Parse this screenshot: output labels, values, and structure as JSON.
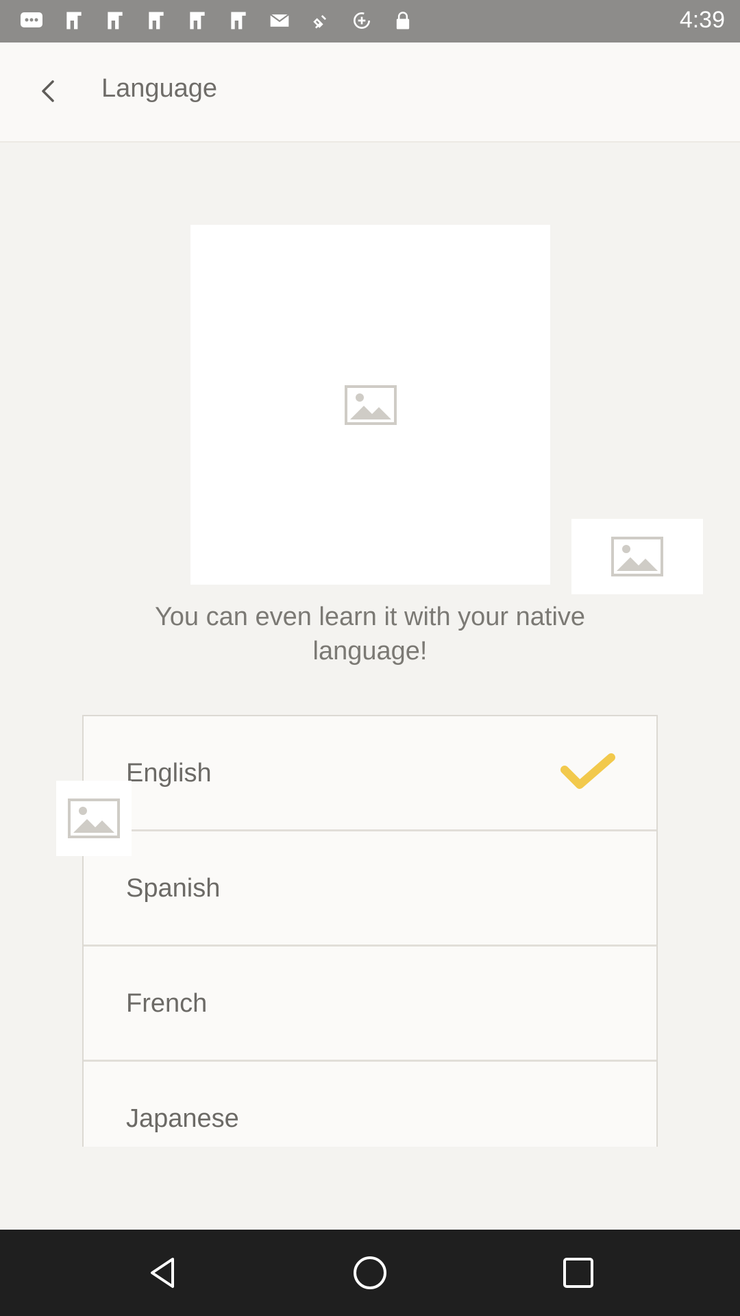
{
  "status_bar": {
    "time": "4:39",
    "icons": [
      "chat-bubble-icon",
      "game-icon",
      "game-icon",
      "game-icon",
      "game-icon",
      "game-icon",
      "email-icon",
      "fake-gps-icon",
      "data-saver-icon",
      "lock-icon"
    ]
  },
  "app_bar": {
    "back_icon": "chevron-left-icon",
    "title": "Language"
  },
  "main": {
    "tagline": "You can even learn it with your native language!",
    "images": [
      "image-placeholder-icon",
      "image-placeholder-icon",
      "image-placeholder-icon"
    ]
  },
  "languages": {
    "items": [
      {
        "label": "English",
        "selected": true
      },
      {
        "label": "Spanish",
        "selected": false
      },
      {
        "label": "French",
        "selected": false
      },
      {
        "label": "Japanese",
        "selected": false
      }
    ],
    "check_icon": "checkmark-icon"
  },
  "colors": {
    "accent_check": "#f2c94c",
    "status_bar": "#8d8c8a",
    "background": "#f4f3f0"
  },
  "nav_bar": {
    "icons": [
      "back-triangle-icon",
      "home-circle-icon",
      "recents-square-icon"
    ]
  }
}
